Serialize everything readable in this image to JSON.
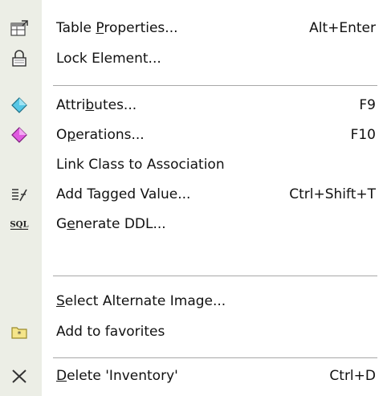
{
  "colors": {
    "gutter": "#eceee6",
    "text": "#111111",
    "separator": "#a8a8a8"
  },
  "menu": {
    "items": [
      {
        "name": "table-properties",
        "pre": "Table ",
        "mn": "P",
        "post": "roperties...",
        "shortcut": "Alt+Enter",
        "icon": "table-properties-icon"
      },
      {
        "name": "lock-element",
        "pre": "Lock Element...",
        "mn": "",
        "post": "",
        "shortcut": "",
        "icon": "lock-icon"
      },
      {
        "name": "attributes",
        "pre": "Attri",
        "mn": "b",
        "post": "utes...",
        "shortcut": "F9",
        "icon": "attributes-icon"
      },
      {
        "name": "operations",
        "pre": "O",
        "mn": "p",
        "post": "erations...",
        "shortcut": "F10",
        "icon": "operations-icon"
      },
      {
        "name": "link-class",
        "pre": "Link Class to Association",
        "mn": "",
        "post": "",
        "shortcut": "",
        "icon": ""
      },
      {
        "name": "add-tagged-value",
        "pre": "Add Tagged Value...",
        "mn": "",
        "post": "",
        "shortcut": "Ctrl+Shift+T",
        "icon": "tagged-value-icon"
      },
      {
        "name": "generate-ddl",
        "pre": "G",
        "mn": "e",
        "post": "nerate DDL...",
        "shortcut": "",
        "icon": "sql-icon"
      },
      {
        "name": "select-alternate-image",
        "pre": "",
        "mn": "S",
        "post": "elect Alternate Image...",
        "shortcut": "",
        "icon": ""
      },
      {
        "name": "add-to-favorites",
        "pre": "Add to favorites",
        "mn": "",
        "post": "",
        "shortcut": "",
        "icon": "favorites-icon"
      },
      {
        "name": "delete",
        "pre": "",
        "mn": "D",
        "post": "elete 'Inventory'",
        "shortcut": "Ctrl+D",
        "icon": "delete-icon"
      }
    ],
    "sql_icon_text": "SQL"
  }
}
